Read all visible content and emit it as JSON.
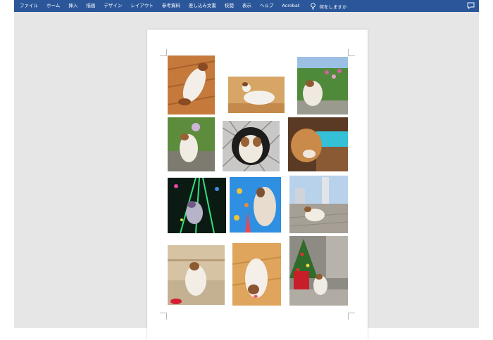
{
  "ribbon": {
    "tabs": [
      "ファイル",
      "ホーム",
      "挿入",
      "描画",
      "デザイン",
      "レイアウト",
      "参考資料",
      "差し込み文書",
      "校閲",
      "表示",
      "ヘルプ",
      "Acrobat"
    ],
    "tell_me": "何をしますか",
    "tell_me_icon": "lightbulb-icon",
    "comment_icon": "comment-icon"
  },
  "colors": {
    "ribbon_bg": "#2b579a",
    "workspace_bg": "#e6e6e6",
    "page_bg": "#ffffff"
  }
}
